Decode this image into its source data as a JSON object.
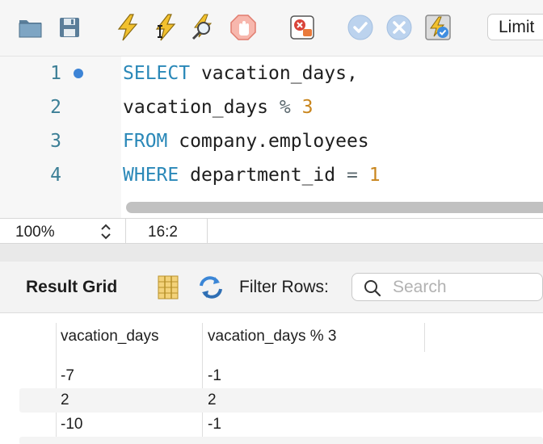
{
  "toolbar": {
    "icons": [
      "open-folder-icon",
      "save-icon",
      "execute-icon",
      "execute-current-icon",
      "explain-icon",
      "stop-icon",
      "toggle-error-stop-icon",
      "commit-icon",
      "rollback-icon",
      "autocommit-icon"
    ],
    "limit_label": "Limit"
  },
  "editor": {
    "lines": [
      {
        "number": "1",
        "tokens": [
          {
            "t": "SELECT",
            "c": "kw"
          },
          {
            "t": " vacation_days,",
            "c": ""
          }
        ]
      },
      {
        "number": "2",
        "tokens": [
          {
            "t": "vacation_days ",
            "c": ""
          },
          {
            "t": "%",
            "c": "op"
          },
          {
            "t": " ",
            "c": ""
          },
          {
            "t": "3",
            "c": "num"
          }
        ]
      },
      {
        "number": "3",
        "tokens": [
          {
            "t": "FROM",
            "c": "kw"
          },
          {
            "t": " company.employees",
            "c": ""
          }
        ]
      },
      {
        "number": "4",
        "tokens": [
          {
            "t": "WHERE",
            "c": "kw"
          },
          {
            "t": " department_id ",
            "c": ""
          },
          {
            "t": "=",
            "c": "op"
          },
          {
            "t": " ",
            "c": ""
          },
          {
            "t": "1",
            "c": "num"
          }
        ]
      }
    ],
    "colors": {
      "keyword": "#2a88b8",
      "number": "#c9861e",
      "operator": "#5d6a70",
      "line_number": "#3c7f96",
      "marker": "#3d84d6"
    }
  },
  "status": {
    "zoom": "100%",
    "cursor_position": "16:2"
  },
  "result_bar": {
    "title": "Result Grid",
    "filter_label": "Filter Rows:",
    "search_placeholder": "Search"
  },
  "grid": {
    "columns": [
      "vacation_days",
      "vacation_days % 3"
    ],
    "rows": [
      [
        "-7",
        "-1"
      ],
      [
        "2",
        "2"
      ],
      [
        "-10",
        "-1"
      ]
    ]
  }
}
